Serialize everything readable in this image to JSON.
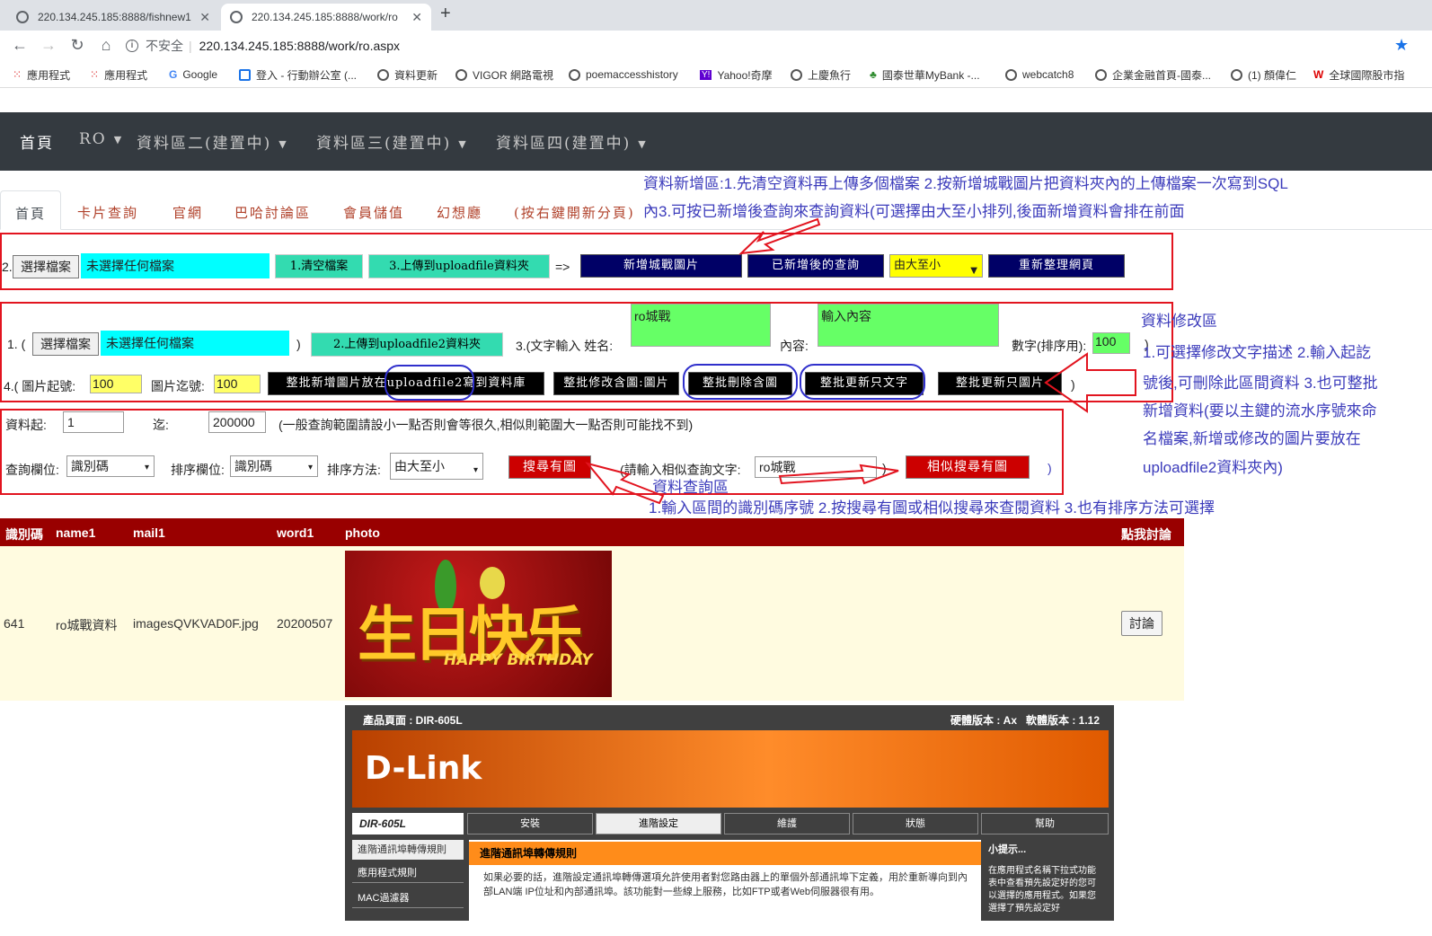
{
  "browser": {
    "tabs": [
      {
        "title": "220.134.245.185:8888/fishnew1"
      },
      {
        "title": "220.134.245.185:8888/work/ro"
      }
    ],
    "new_tab": "+",
    "security": "不安全",
    "url": "220.134.245.185:8888/work/ro.aspx",
    "bookmarks": [
      "應用程式",
      "應用程式",
      "Google",
      "登入 - 行動辦公室 (...",
      "資料更新",
      "VIGOR 網路電視",
      "poemaccesshistory",
      "Yahoo!奇摩",
      "上慶魚行",
      "國泰世華MyBank -...",
      "webcatch8",
      "企業金融首頁-國泰...",
      "(1) 顏偉仁",
      "全球國際股市指"
    ]
  },
  "nav": {
    "items": [
      "首頁",
      "RO",
      "資料區二(建置中)",
      "資料區三(建置中)",
      "資料區四(建置中)"
    ]
  },
  "tabs": [
    "首頁",
    "卡片查詢",
    "官網",
    "巴哈討論區",
    "會員儲值",
    "幻想廳",
    "(按右鍵開新分頁)"
  ],
  "annotations": {
    "add_1": "資料新增區:1.先清空資料再上傳多個檔案 2.按新增城戰圖片把資料夾內的上傳檔案一次寫到SQL",
    "add_2": "內3.可按已新增後查詢來查詢資料(可選擇由大至小排列,後面新增資料會排在前面",
    "edit_title": "資料修改區",
    "edit_1": "1.可選擇修改文字描述 2.輸入起訖",
    "edit_2": "號後,可刪除此區間資料 3.也可整批",
    "edit_3": "新增資料(要以主鍵的流水序號來命",
    "edit_4": "名檔案,新增或修改的圖片要放在",
    "edit_5": "uploadfile2資料夾內)",
    "query_title": "資料查詢區",
    "query_1": "1.輸入區間的識別碼序號 2.按搜尋有圖或相似搜尋來查閱資料 3.也有排序方法可選擇"
  },
  "section1": {
    "prefix": "2.",
    "choose_file": "選擇檔案",
    "no_file": "未選擇任何檔案",
    "clear": "1.清空檔案",
    "upload": "3.上傳到uploadfile資料夾",
    "arrow": "=>",
    "add_pics": "新增城戰圖片",
    "query_after": "已新增後的查詢",
    "order": "由大至小",
    "refresh": "重新整理網頁"
  },
  "section2": {
    "prefix": "1. (",
    "choose_file": "選擇檔案",
    "no_file": "未選擇任何檔案",
    "close": ")",
    "upload2": "2.上傳到uploadfile2資料夾",
    "text_label": "3.(文字輸入 姓名:",
    "name_value": "ro城戰",
    "content_label": "內容:",
    "content_value": "輸入內容",
    "num_label": "數字(排序用):",
    "num_value": "100",
    "num_close": ")",
    "start_label": "4.( 圖片起號:",
    "start_value": "100",
    "end_label": "圖片迄號:",
    "end_value": "100",
    "batch_add": "整批新增圖片放在uploadfile2寫到資料庫",
    "batch_edit": "整批修改含圖:圖片",
    "batch_delete": "整批刪除含圖",
    "batch_text": "整批更新只文字",
    "batch_pic": "整批更新只圖片",
    "end_paren": ")"
  },
  "section3": {
    "from_label": "資料起:",
    "from_value": "1",
    "to_label": "迄:",
    "to_value": "200000",
    "hint": "(一般查詢範圍請設小一點否則會等很久,相似則範圍大一點否則可能找不到)",
    "field_label": "查詢欄位:",
    "field_value": "識別碼",
    "sort_label": "排序欄位:",
    "sort_value": "識別碼",
    "method_label": "排序方法:",
    "method_value": "由大至小",
    "search": "搜尋有圖",
    "similar_label": "(請輸入相似查詢文字:",
    "similar_value": "ro城戰",
    "similar_close": ")",
    "similar_btn": "相似搜尋有圖",
    "end_paren": ")"
  },
  "table": {
    "headers": [
      "識別碼",
      "name1",
      "mail1",
      "word1",
      "photo",
      "點我討論"
    ],
    "row": {
      "id": "641",
      "name": "ro城戰資料",
      "mail": "imagesQVKVAD0F.jpg",
      "word": "20200507",
      "discuss": "討論"
    }
  },
  "photo": {
    "text": "生日快乐",
    "sub": "HAPPY BIRTHDAY"
  },
  "dlink": {
    "product": "產品頁面 : DIR-605L",
    "version": "硬體版本 : Ax   軟體版本 : 1.12",
    "logo": "D-Link",
    "model": "DIR-605L",
    "tabs": [
      "安裝",
      "進階設定",
      "維護",
      "狀態",
      "幫助"
    ],
    "side": [
      "進階通訊埠轉傳規則",
      "應用程式規則",
      "MAC過濾器"
    ],
    "panel_title": "進階通訊埠轉傳規則",
    "panel_text": "如果必要的話，進階設定通訊埠轉傳選項允許使用者對您路由器上的單個外部通訊埠下定義，用於重新導向到內部LAN端 IP位址和內部通訊埠。該功能對一些線上服務，比如FTP或者Web伺服器很有用。",
    "hint_title": "小提示...",
    "hint_text": "在應用程式名稱下拉式功能表中查看預先設定好的您可以選擇的應用程式。如果您選擇了預先設定好"
  },
  "colors": {
    "navbar": "#343a40",
    "red": "#e2141f",
    "annot": "#3b3bbb",
    "table_head": "#990000",
    "table_row": "#fffbe0"
  }
}
